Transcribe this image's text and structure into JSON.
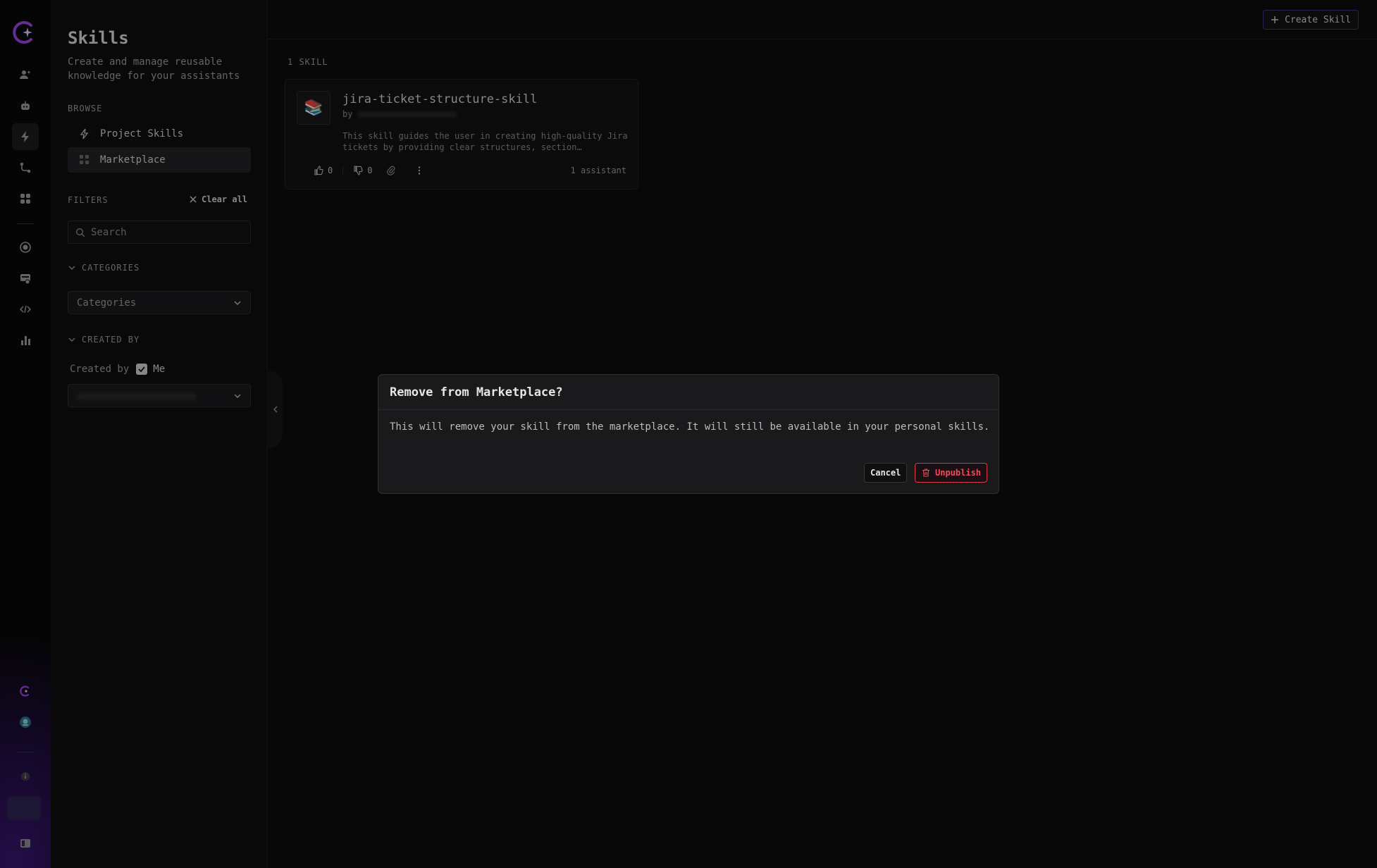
{
  "sidebar": {
    "title": "Skills",
    "subtitle": "Create and manage reusable knowledge for your assistants",
    "browse_label": "BROWSE",
    "nav": [
      {
        "label": "Project Skills",
        "icon": "lightning-icon"
      },
      {
        "label": "Marketplace",
        "icon": "grid-icon"
      }
    ],
    "filters_label": "FILTERS",
    "clear_all": "Clear all",
    "search_placeholder": "Search",
    "categories_head": "CATEGORIES",
    "categories_select": "Categories",
    "created_by_head": "CREATED BY",
    "created_by_label": "Created by",
    "me_label": "Me",
    "me_checked": true
  },
  "toolbar": {
    "create_label": "Create Skill"
  },
  "main": {
    "count_label": "1 SKILL",
    "card": {
      "icon": "📚",
      "title": "jira-ticket-structure-skill",
      "by": "by",
      "description": "This skill guides the user in creating high-quality Jira tickets by providing clear structures, section…",
      "likes": "0",
      "dislikes": "0",
      "assistants": "1 assistant"
    }
  },
  "modal": {
    "title": "Remove from Marketplace?",
    "body": "This will remove your skill from the marketplace. It will still be available in your personal skills.",
    "cancel": "Cancel",
    "unpublish": "Unpublish"
  },
  "colors": {
    "accent": "#8b3fd9",
    "danger": "#ef4b5b",
    "background": "#0d0d0e"
  }
}
